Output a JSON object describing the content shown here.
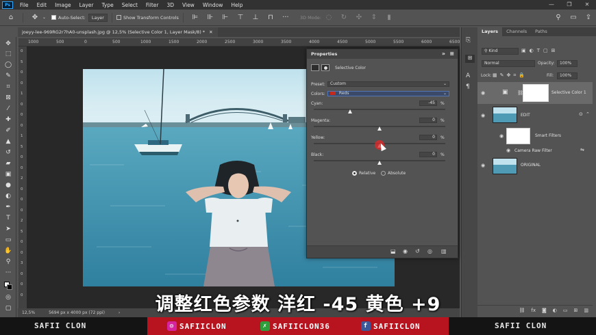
{
  "menubar": {
    "app_icon": "Ps",
    "items": [
      "File",
      "Edit",
      "Image",
      "Layer",
      "Type",
      "Select",
      "Filter",
      "3D",
      "View",
      "Window",
      "Help"
    ],
    "window_controls": [
      "—",
      "❐",
      "✕"
    ]
  },
  "options_bar": {
    "auto_select_label": "Auto-Select:",
    "auto_select_value": "Layer",
    "show_transform_label": "Show Transform Controls",
    "mode_3d_label": "3D Mode:"
  },
  "document": {
    "tab_title": "joeyy-lee-969RG2r7hA0-unsplash.jpg @ 12,5% (Selective Color 1, Layer Mask/8) *",
    "zoom": "12,5%",
    "dimensions": "5694 px x 4000 px (72 ppi)",
    "ruler_h": [
      "1000",
      "500",
      "0",
      "500",
      "1000",
      "1500",
      "2000",
      "2500",
      "3000",
      "3500",
      "4000",
      "4500",
      "5000",
      "5500",
      "6000",
      "6500"
    ],
    "ruler_v": [
      "0",
      "5",
      "0",
      "0",
      "1",
      "0",
      "0",
      "0",
      "1",
      "5",
      "0",
      "0",
      "2",
      "0",
      "0",
      "0",
      "2",
      "5",
      "0",
      "0",
      "3",
      "0",
      "0",
      "0"
    ]
  },
  "properties": {
    "title": "Properties",
    "adjustment_label": "Selective Color",
    "preset_label": "Preset:",
    "preset_value": "Custom",
    "colors_label": "Colors:",
    "colors_value": "Reds",
    "sliders": [
      {
        "label": "Cyan:",
        "value": "-45",
        "unit": "%",
        "level": -45
      },
      {
        "label": "Magenta:",
        "value": "0",
        "unit": "%",
        "level": 0
      },
      {
        "label": "Yellow:",
        "value": "0",
        "unit": "%",
        "level": 0
      },
      {
        "label": "Black:",
        "value": "0",
        "unit": "%",
        "level": 0
      }
    ],
    "method_relative": "Relative",
    "method_absolute": "Absolute"
  },
  "layers_panel": {
    "tabs": [
      "Layers",
      "Channels",
      "Paths"
    ],
    "filter_label": "Kind",
    "blend_mode": "Normal",
    "opacity_label": "Opacity:",
    "opacity_value": "100%",
    "lock_label": "Lock:",
    "fill_label": "Fill:",
    "fill_value": "100%",
    "layers": [
      {
        "name": "Selective Color 1"
      },
      {
        "name": "EDIT"
      },
      {
        "name": "Smart Filters"
      },
      {
        "name": "Camera Raw Filter"
      },
      {
        "name": "ORIGINAL"
      }
    ]
  },
  "subtitle": "调整红色参数 洋红 -45 黄色 +9",
  "banner": {
    "left_name": "SAFII CLON",
    "right_name": "SAFII CLON",
    "instagram": "SAFIICLON",
    "other": "SAFIICLON36",
    "facebook": "SAFIICLON",
    "colors": {
      "accent": "#b81420",
      "instagram": "#d6249f",
      "other": "#2e9e3c",
      "facebook": "#3b5998"
    }
  }
}
